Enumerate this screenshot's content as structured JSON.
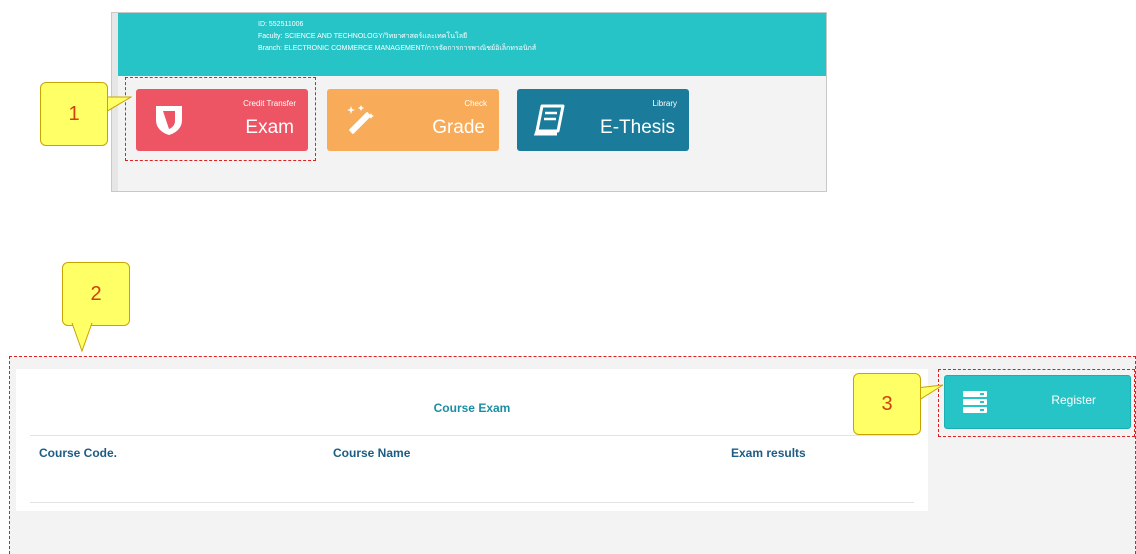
{
  "student": {
    "id_line": "ID: 552511006",
    "faculty_line": "Faculty: SCIENCE AND TECHNOLOGY/วิทยาศาสตร์และเทคโนโลยี",
    "branch_line": "Branch: ELECTRONIC COMMERCE MANAGEMENT/การจัดการการพาณิชย์อิเล็กทรอนิกส์"
  },
  "tiles": {
    "exam": {
      "small": "Credit Transfer",
      "big": "Exam",
      "color": "#ed5565",
      "icon": "shield-icon"
    },
    "grade": {
      "small": "Check",
      "big": "Grade",
      "color": "#f8ac59",
      "icon": "magic-wand-icon"
    },
    "thesis": {
      "small": "Library",
      "big": "E-Thesis",
      "color": "#1a7b9b",
      "icon": "book-icon"
    }
  },
  "callouts": {
    "one": "1",
    "two": "2",
    "three": "3"
  },
  "course_exam": {
    "title": "Course Exam",
    "columns": [
      "Course Code.",
      "Course Name",
      "Exam results"
    ]
  },
  "register": {
    "label": "Register",
    "icon": "server-icon",
    "color": "#26c3c7"
  },
  "colors": {
    "header": "#26c3c7",
    "callout": "#ffff66",
    "highlight": "#e02020"
  }
}
